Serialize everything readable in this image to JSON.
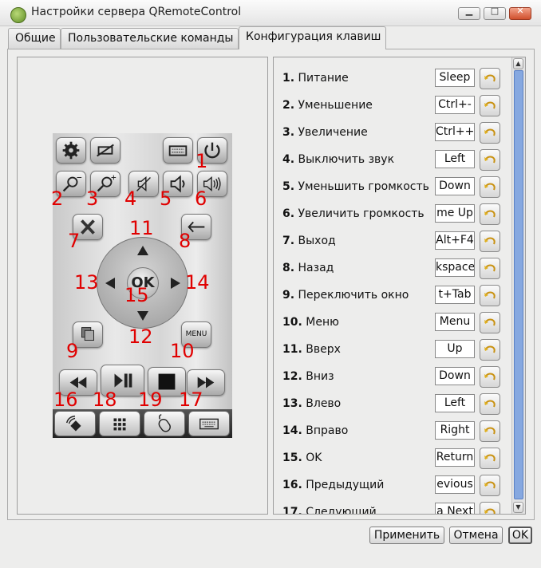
{
  "window": {
    "title": "Настройки сервера QRemoteControl",
    "minimize_glyph": "▁",
    "maximize_glyph": "□",
    "close_glyph": "✕"
  },
  "tabs": [
    {
      "label": "Общие",
      "active": false
    },
    {
      "label": "Пользовательские команды",
      "active": false
    },
    {
      "label": "Конфигурация клавиш",
      "active": true
    }
  ],
  "remote_image": {
    "ok_label": "OK",
    "menu_label": "MENU",
    "numbers": [
      "1",
      "2",
      "3",
      "4",
      "5",
      "6",
      "7",
      "8",
      "9",
      "10",
      "11",
      "12",
      "13",
      "14",
      "15",
      "16",
      "17",
      "18",
      "19"
    ],
    "number_color": "#e00000"
  },
  "key_bindings": [
    {
      "num": "1.",
      "label": "Питание",
      "key": "Sleep"
    },
    {
      "num": "2.",
      "label": "Уменьшение",
      "key": "Ctrl+-"
    },
    {
      "num": "3.",
      "label": "Увеличение",
      "key": "Ctrl++"
    },
    {
      "num": "4.",
      "label": "Выключить звук",
      "key": "Left"
    },
    {
      "num": "5.",
      "label": "Уменьшить громкость",
      "key": "Down"
    },
    {
      "num": "6.",
      "label": "Увеличить громкость",
      "key": "me Up"
    },
    {
      "num": "7.",
      "label": "Выход",
      "key": "Alt+F4"
    },
    {
      "num": "8.",
      "label": "Назад",
      "key": "kspace"
    },
    {
      "num": "9.",
      "label": "Переключить окно",
      "key": "t+Tab"
    },
    {
      "num": "10.",
      "label": "Меню",
      "key": "Menu"
    },
    {
      "num": "11.",
      "label": "Вверх",
      "key": "Up"
    },
    {
      "num": "12.",
      "label": "Вниз",
      "key": "Down"
    },
    {
      "num": "13.",
      "label": "Влево",
      "key": "Left"
    },
    {
      "num": "14.",
      "label": "Вправо",
      "key": "Right"
    },
    {
      "num": "15.",
      "label": "OK",
      "key": "Return"
    },
    {
      "num": "16.",
      "label": "Предыдущий",
      "key": "evious"
    },
    {
      "num": "17.",
      "label": "Следующий",
      "key": "a Next"
    }
  ],
  "reset_icon": "undo-arrow-icon",
  "buttons": {
    "apply": "Применить",
    "cancel": "Отмена",
    "ok": "OK"
  },
  "colors": {
    "scrollbar_thumb": "#86a8e0",
    "reset_arrow": "#e0b020"
  }
}
